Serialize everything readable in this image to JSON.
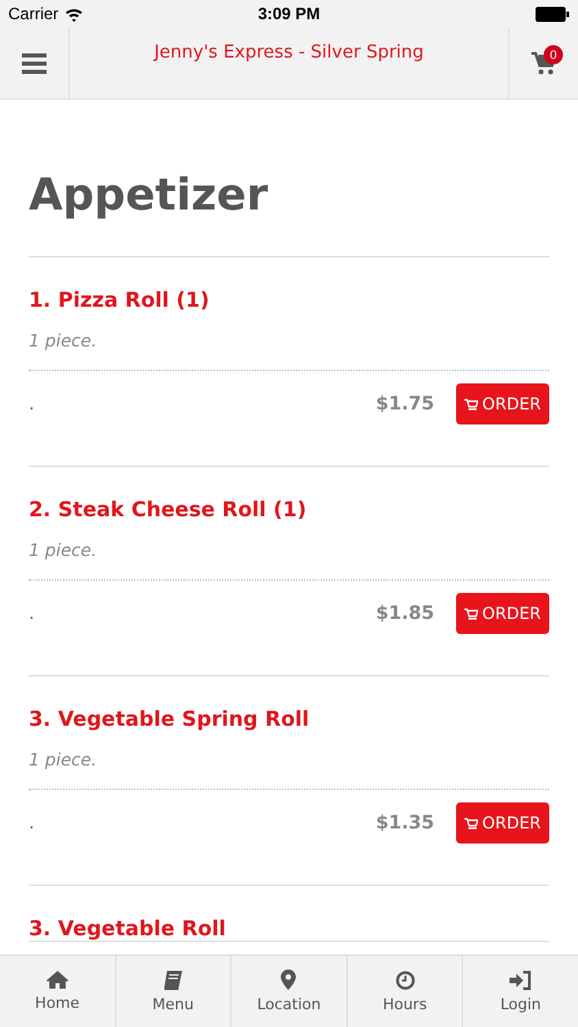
{
  "status_bar": {
    "carrier": "Carrier",
    "time": "3:09 PM"
  },
  "header": {
    "title": "Jenny's Express - Silver Spring",
    "cart_count": "0"
  },
  "section": {
    "title": "Appetizer"
  },
  "items": [
    {
      "name": "1. Pizza Roll (1)",
      "description": "1 piece.",
      "note": ".",
      "price": "$1.75",
      "button": "ORDER"
    },
    {
      "name": "2. Steak Cheese Roll (1)",
      "description": "1 piece.",
      "note": ".",
      "price": "$1.85",
      "button": "ORDER"
    },
    {
      "name": "3. Vegetable Spring Roll",
      "description": "1 piece.",
      "note": ".",
      "price": "$1.35",
      "button": "ORDER"
    },
    {
      "name": "3. Vegetable Roll"
    }
  ],
  "tab_bar": [
    {
      "label": "Home",
      "kind": "home"
    },
    {
      "label": "Menu",
      "kind": "menu"
    },
    {
      "label": "Location",
      "kind": "location"
    },
    {
      "label": "Hours",
      "kind": "hours"
    },
    {
      "label": "Login",
      "kind": "login"
    }
  ]
}
